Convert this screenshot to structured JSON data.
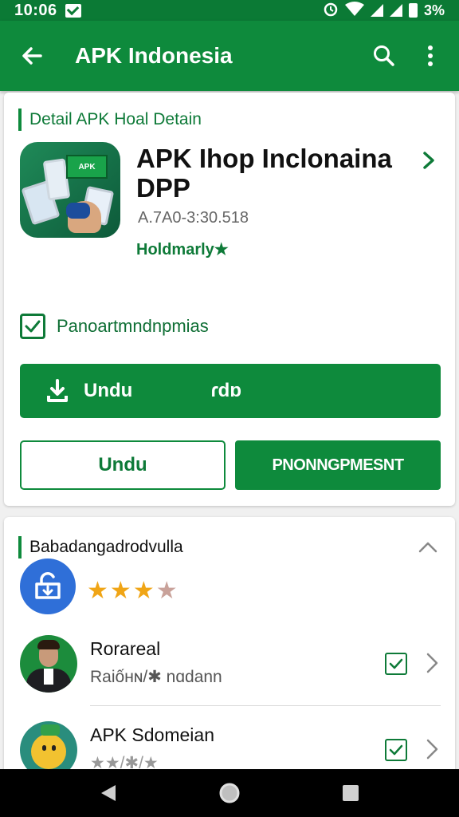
{
  "status_bar": {
    "time": "10:06",
    "right_text": "3%",
    "icons": [
      "mail-icon",
      "alarm-icon",
      "wifi-icon",
      "signal-icon",
      "battery-icon"
    ]
  },
  "app_bar": {
    "title": "APK Indonesia",
    "icons": [
      "back-arrow-icon",
      "search-icon",
      "more-vert-icon"
    ]
  },
  "detail_card": {
    "section_label": "Detail APK Hoal Detain",
    "app_name": "APK Ihop Inclonaina DPP",
    "version": "A.7A0-3:30.518",
    "developer": "Holdmarly★",
    "checkbox_label": "Panoartmndnpmias",
    "checkbox_checked": true,
    "primary_button": {
      "label": "Undu",
      "secondary_label": "ɾdɒ"
    },
    "outline_button": "Undu",
    "solid_button": "PNONNGPMESNT"
  },
  "related_card": {
    "section_label": "Babadangadrodvulla",
    "rating": {
      "stars": 3,
      "of": 4
    },
    "items": [
      {
        "title": "Rorareal",
        "subtitle": "Raiốʜɴ/✱ nɑdann",
        "checked": true
      },
      {
        "title": "APK Sdomeian",
        "subtitle": "★★/✱/★",
        "checked": true
      }
    ]
  },
  "nav_bar": {
    "icons": [
      "back-triangle-icon",
      "home-circle-icon",
      "recents-square-icon"
    ]
  },
  "colors": {
    "primary_green": "#0e8a3c",
    "dark_green": "#0b7a35",
    "star": "#f0a516",
    "link_blue": "#2f6fd8"
  }
}
